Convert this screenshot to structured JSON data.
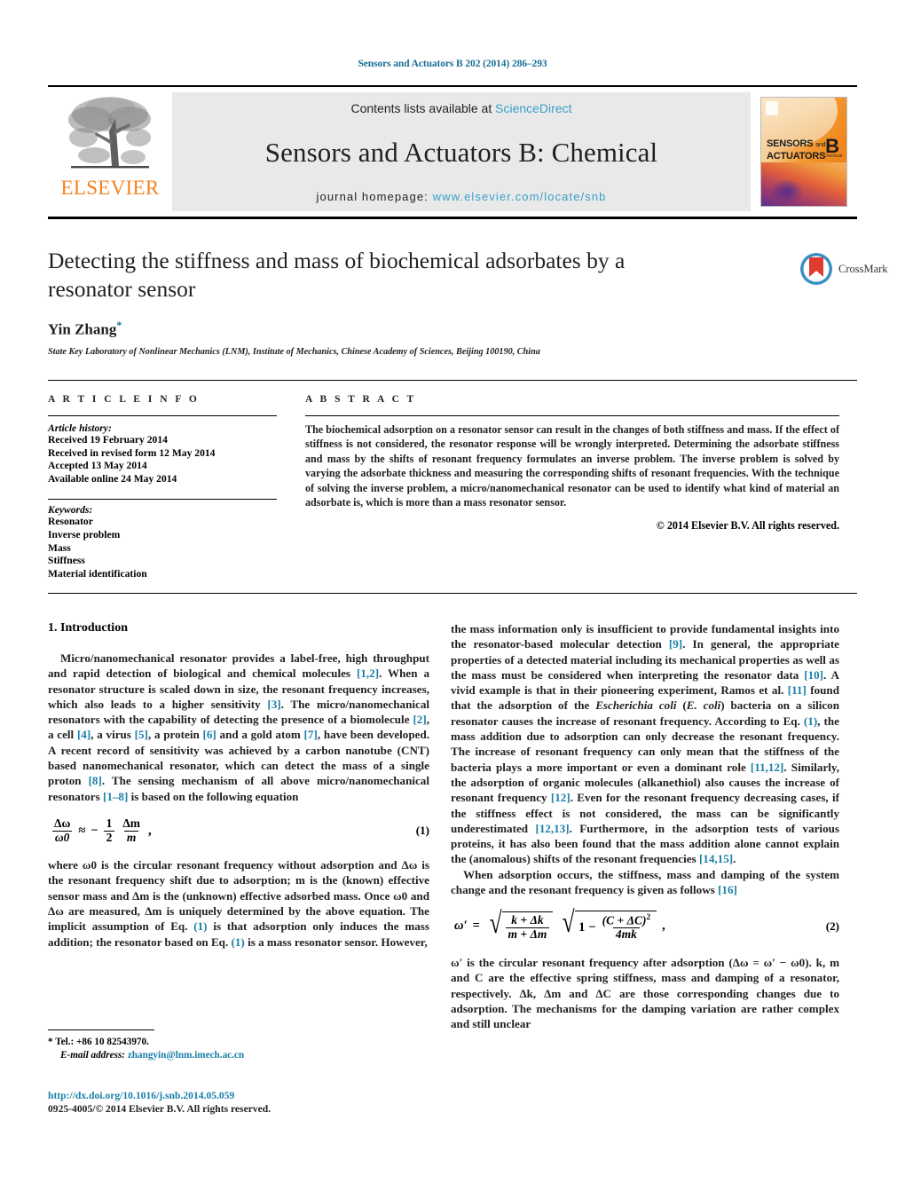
{
  "running_head": "Sensors and Actuators B 202 (2014) 286–293",
  "masthead": {
    "publisher_name": "ELSEVIER",
    "contents_prefix": "Contents lists available at ",
    "sciencedirect": "ScienceDirect",
    "journal_name": "Sensors and Actuators B: Chemical",
    "homepage_prefix": "journal homepage: ",
    "homepage_url": "www.elsevier.com/locate/snb",
    "cover": {
      "line1": "SENSORS",
      "line1_small": "and",
      "line2": "ACTUATORS",
      "letter": "B",
      "letter_sub": "Chemical"
    }
  },
  "article": {
    "title": "Detecting the stiffness and mass of biochemical adsorbates by a resonator sensor",
    "author": "Yin Zhang",
    "author_marker": "*",
    "affiliation": "State Key Laboratory of Nonlinear Mechanics (LNM), Institute of Mechanics, Chinese Academy of Sciences, Beijing 100190, China",
    "crossmark_label": "CrossMark"
  },
  "article_info": {
    "heading": "A R T I C L E    I N F O",
    "history_heading": "Article history:",
    "history": [
      "Received 19 February 2014",
      "Received in revised form 12 May 2014",
      "Accepted 13 May 2014",
      "Available online 24 May 2014"
    ],
    "keywords_heading": "Keywords:",
    "keywords": [
      "Resonator",
      "Inverse problem",
      "Mass",
      "Stiffness",
      "Material identification"
    ]
  },
  "abstract": {
    "heading": "A B S T R A C T",
    "text": "The biochemical adsorption on a resonator sensor can result in the changes of both stiffness and mass. If the effect of stiffness is not considered, the resonator response will be wrongly interpreted. Determining the adsorbate stiffness and mass by the shifts of resonant frequency formulates an inverse problem. The inverse problem is solved by varying the adsorbate thickness and measuring the corresponding shifts of resonant frequencies. With the technique of solving the inverse problem, a micro/nanomechanical resonator can be used to identify what kind of material an adsorbate is, which is more than a mass resonator sensor.",
    "copyright": "© 2014 Elsevier B.V. All rights reserved."
  },
  "body": {
    "section_title": "1.  Introduction",
    "left_p1_a": "Micro/nanomechanical resonator provides a label-free, high throughput and rapid detection of biological and chemical molecules ",
    "left_p1_r1": "[1,2]",
    "left_p1_b": ". When a resonator structure is scaled down in size, the resonant frequency increases, which also leads to a higher sensitivity ",
    "left_p1_r2": "[3]",
    "left_p1_c": ". The micro/nanomechanical resonators with the capability of detecting the presence of a biomolecule ",
    "left_p1_r3": "[2]",
    "left_p1_d": ", a cell ",
    "left_p1_r4": "[4]",
    "left_p1_e": ", a virus ",
    "left_p1_r5": "[5]",
    "left_p1_f": ", a protein ",
    "left_p1_r6": "[6]",
    "left_p1_g": " and a gold atom ",
    "left_p1_r7": "[7]",
    "left_p1_h": ", have been developed. A recent record of sensitivity was achieved by a carbon nanotube (CNT) based nanomechanical resonator, which can detect the mass of a single proton ",
    "left_p1_r8": "[8]",
    "left_p1_i": ". The sensing mechanism of all above micro/nanomechanical resonators ",
    "left_p1_r9": "[1–8]",
    "left_p1_j": " is based on the following equation",
    "eq1": {
      "lhs_num": "Δω",
      "lhs_den": "ω0",
      "approx": "≈",
      "minus": "−",
      "rhs1_num": "1",
      "rhs1_den": "2",
      "rhs2_num": "Δm",
      "rhs2_den": "m",
      "comma": ",",
      "number": "(1)"
    },
    "left_p2_a": "where ω0 is the circular resonant frequency without adsorption and Δω is the resonant frequency shift due to adsorption; m is the (known) effective sensor mass and Δm is the (unknown) effective adsorbed mass. Once ω0 and Δω are measured, Δm is uniquely determined by the above equation. The implicit assumption of Eq. ",
    "left_p2_r1": "(1)",
    "left_p2_b": " is that adsorption only induces the mass addition; the resonator based on Eq. ",
    "left_p2_r2": "(1)",
    "left_p2_c": " is a mass resonator sensor. However,",
    "right_p1_a": "the mass information only is insufficient to provide fundamental insights into the resonator-based molecular detection ",
    "right_p1_r1": "[9]",
    "right_p1_b": ". In general, the appropriate properties of a detected material including its mechanical properties as well as the mass must be considered when interpreting the resonator data ",
    "right_p1_r2": "[10]",
    "right_p1_c": ". A vivid example is that in their pioneering experiment, Ramos et al. ",
    "right_p1_r3": "[11]",
    "right_p1_d": " found that the adsorption of the ",
    "right_p1_italic1": "Escherichia coli",
    "right_p1_e": " (",
    "right_p1_italic2": "E. coli",
    "right_p1_f": ") bacteria on a silicon resonator causes the increase of resonant frequency. According to Eq. ",
    "right_p1_r4": "(1)",
    "right_p1_g": ", the mass addition due to adsorption can only decrease the resonant frequency. The increase of resonant frequency can only mean that the stiffness of the bacteria plays a more important or even a dominant role ",
    "right_p1_r5": "[11,12]",
    "right_p1_h": ". Similarly, the adsorption of organic molecules (alkanethiol) also causes the increase of resonant frequency ",
    "right_p1_r6": "[12]",
    "right_p1_i": ". Even for the resonant frequency decreasing cases, if the stiffness effect is not considered, the mass can be significantly underestimated ",
    "right_p1_r7": "[12,13]",
    "right_p1_j": ". Furthermore, in the adsorption tests of various proteins, it has also been found that the mass addition alone cannot explain the (anomalous) shifts of the resonant frequencies ",
    "right_p1_r8": "[14,15]",
    "right_p1_k": ".",
    "right_p2_a": "When adsorption occurs, the stiffness, mass and damping of the system change and the resonant frequency is given as follows ",
    "right_p2_r1": "[16]",
    "eq2": {
      "lhs": "ω′",
      "eq": "=",
      "f1_num": "k + Δk",
      "f1_den": "m + Δm",
      "one": "1",
      "minus": "−",
      "f2_num": "(C + ΔC)",
      "f2_num_sup": "2",
      "f2_den": "4mk",
      "comma": ",",
      "number": "(2)"
    },
    "right_p3": "ω′ is the circular resonant frequency after adsorption (Δω = ω′ − ω0). k, m and C are the effective spring stiffness, mass and damping of a resonator, respectively. Δk, Δm and ΔC are those corresponding changes due to adsorption. The mechanisms for the damping variation are rather complex and still unclear"
  },
  "footer": {
    "tel_marker": "*",
    "tel": "Tel.: +86 10 82543970.",
    "email_label": "E-mail address:",
    "email": "zhangyin@lnm.imech.ac.cn",
    "doi": "http://dx.doi.org/10.1016/j.snb.2014.05.059",
    "issn": "0925-4005/© 2014 Elsevier B.V. All rights reserved."
  },
  "colors": {
    "link": "#1a7fa8",
    "running_head": "#1a6e96",
    "elsevier_orange": "#f58220",
    "sciencedirect": "#3aa0c8"
  }
}
